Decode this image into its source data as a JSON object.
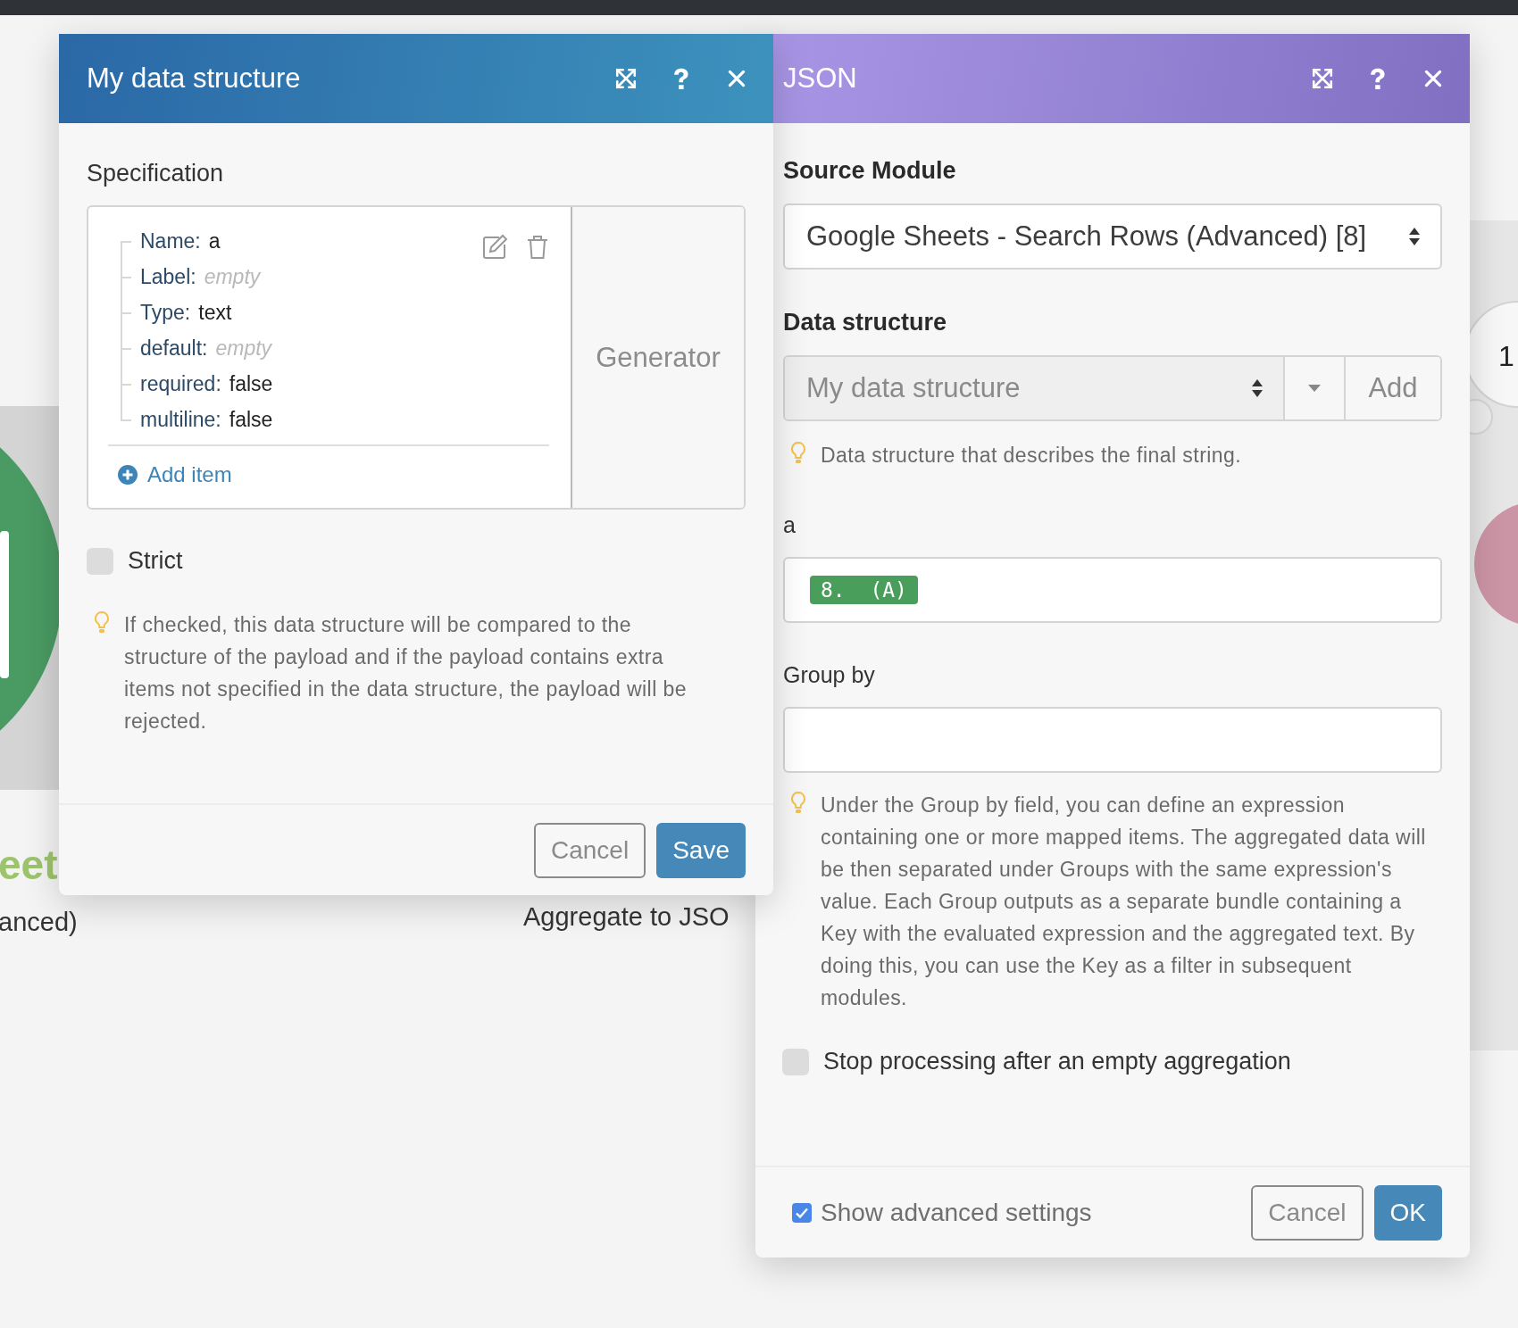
{
  "canvas": {
    "labels": [
      {
        "text": "eet",
        "kind": "app-name"
      },
      {
        "text": "anced)",
        "kind": "module-name"
      },
      {
        "text": "Aggregate to JSO",
        "kind": "module-title"
      },
      {
        "text": "1",
        "kind": "badge"
      }
    ]
  },
  "data_structure_dialog": {
    "title": "My data structure",
    "specification": {
      "label": "Specification",
      "items": [
        {
          "key": "Name:",
          "value": "a",
          "is_empty": false
        },
        {
          "key": "Label:",
          "value": "empty",
          "is_empty": true
        },
        {
          "key": "Type:",
          "value": "text",
          "is_empty": false
        },
        {
          "key": "default:",
          "value": "empty",
          "is_empty": true
        },
        {
          "key": "required:",
          "value": "false",
          "is_empty": false
        },
        {
          "key": "multiline:",
          "value": "false",
          "is_empty": false
        }
      ],
      "add_item": "Add item",
      "generator": "Generator"
    },
    "strict": {
      "label": "Strict",
      "checked": false
    },
    "hint": "If checked, this data structure will be compared to the structure of the payload and if the payload contains extra items not specified in the data structure, the payload will be rejected.",
    "buttons": [
      {
        "label": "Cancel",
        "kind": "secondary"
      },
      {
        "label": "Save",
        "kind": "primary"
      }
    ]
  },
  "json_dialog": {
    "title": "JSON",
    "source_module": {
      "label": "Source Module",
      "value": "Google Sheets - Search Rows (Advanced) [8]"
    },
    "data_structure": {
      "label": "Data structure",
      "value": "My data structure",
      "add": "Add",
      "hint": "Data structure that describes the final string."
    },
    "fields": [
      {
        "label": "a",
        "tokens": [
          "8.  (A)"
        ]
      },
      {
        "label": "Group by"
      }
    ],
    "group_hint": "Under the Group by field, you can define an expression containing one or more mapped items. The aggregated data will be then separated under Groups with the same expression's value. Each Group outputs as a separate bundle containing a Key with the evaluated expression and the aggregated text. By doing this, you can use the Key as a filter in subsequent modules.",
    "stop_processing": {
      "label": "Stop processing after an empty aggregation",
      "checked": false
    },
    "show_advanced": {
      "label": "Show advanced settings",
      "checked": true
    },
    "buttons": [
      {
        "label": "Cancel",
        "kind": "secondary"
      },
      {
        "label": "OK",
        "kind": "primary"
      }
    ]
  }
}
